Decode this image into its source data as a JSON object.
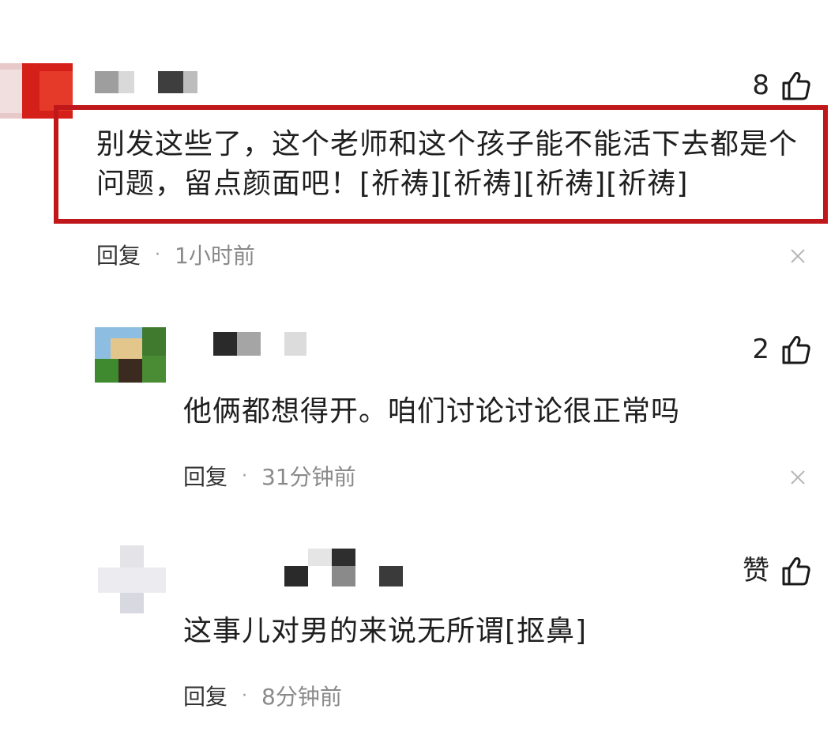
{
  "comments": [
    {
      "likes": "8",
      "text": "别发这些了，这个老师和这个孩子能不能活下去都是个问题，留点颜面吧！[祈祷][祈祷][祈祷][祈祷]",
      "reply_label": "回复",
      "separator": "·",
      "time": "1小时前"
    },
    {
      "likes": "2",
      "text": "他俩都想得开。咱们讨论讨论很正常吗",
      "reply_label": "回复",
      "separator": "·",
      "time": "31分钟前"
    },
    {
      "likes": "赞",
      "text": "这事儿对男的来说无所谓[抠鼻]",
      "reply_label": "回复",
      "separator": "·",
      "time": "8分钟前"
    }
  ],
  "colors": {
    "highlight_border": "#c0171b",
    "time_text": "#8a8a8a"
  },
  "icons": {
    "like": "thumbs-up-icon",
    "close": "close-icon"
  }
}
